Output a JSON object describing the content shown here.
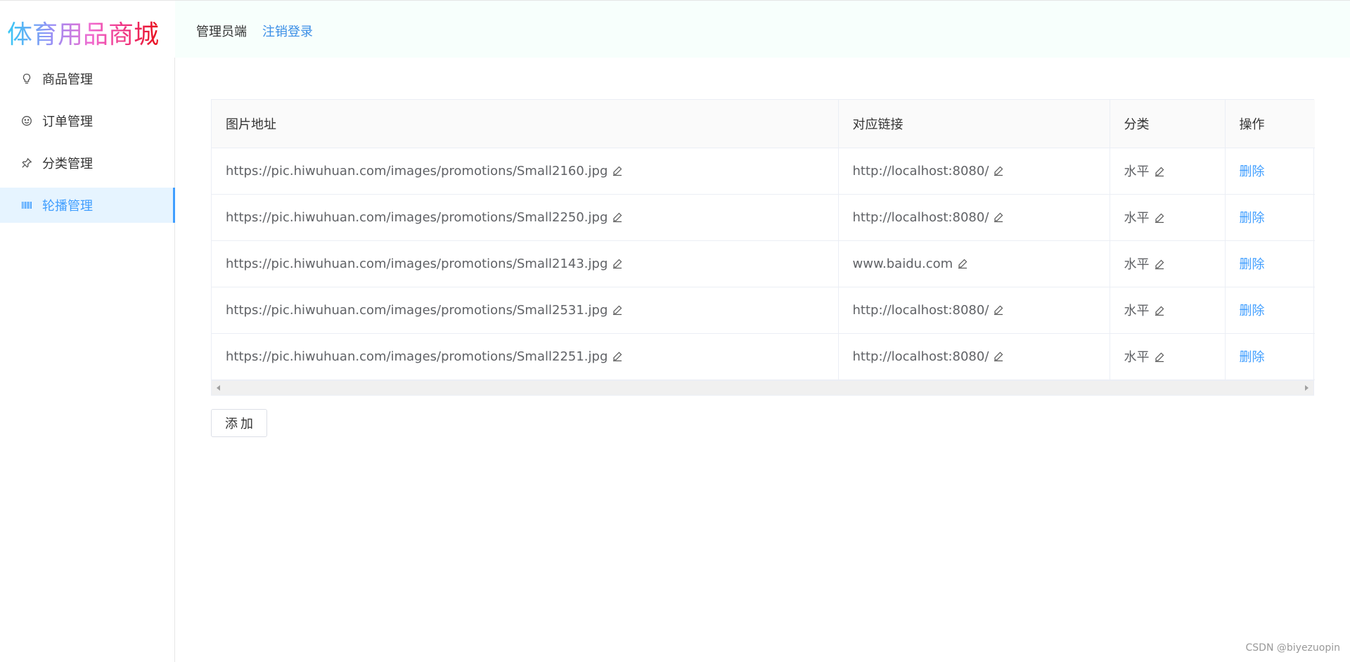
{
  "app": {
    "logo_text": "体育用品商城"
  },
  "header": {
    "role_label": "管理员端",
    "logout_label": "注销登录"
  },
  "sidebar": {
    "items": [
      {
        "label": "商品管理",
        "icon": "lightbulb-icon",
        "active": false
      },
      {
        "label": "订单管理",
        "icon": "smile-icon",
        "active": false
      },
      {
        "label": "分类管理",
        "icon": "pin-icon",
        "active": false
      },
      {
        "label": "轮播管理",
        "icon": "barcode-icon",
        "active": true
      }
    ]
  },
  "table": {
    "columns": [
      "图片地址",
      "对应链接",
      "分类",
      "操作"
    ],
    "rows": [
      {
        "image_url": "https://pic.hiwuhuan.com/images/promotions/Small2160.jpg",
        "link": "http://localhost:8080/",
        "category": "水平",
        "action": "删除"
      },
      {
        "image_url": "https://pic.hiwuhuan.com/images/promotions/Small2250.jpg",
        "link": "http://localhost:8080/",
        "category": "水平",
        "action": "删除"
      },
      {
        "image_url": "https://pic.hiwuhuan.com/images/promotions/Small2143.jpg",
        "link": "www.baidu.com",
        "category": "水平",
        "action": "删除"
      },
      {
        "image_url": "https://pic.hiwuhuan.com/images/promotions/Small2531.jpg",
        "link": "http://localhost:8080/",
        "category": "水平",
        "action": "删除"
      },
      {
        "image_url": "https://pic.hiwuhuan.com/images/promotions/Small2251.jpg",
        "link": "http://localhost:8080/",
        "category": "水平",
        "action": "删除"
      }
    ]
  },
  "buttons": {
    "add_label": "添加"
  },
  "watermark": "CSDN @biyezuopin",
  "colors": {
    "accent": "#409eff",
    "header_bg": "#f7fffc",
    "active_menu_bg": "#e6f4ff"
  }
}
